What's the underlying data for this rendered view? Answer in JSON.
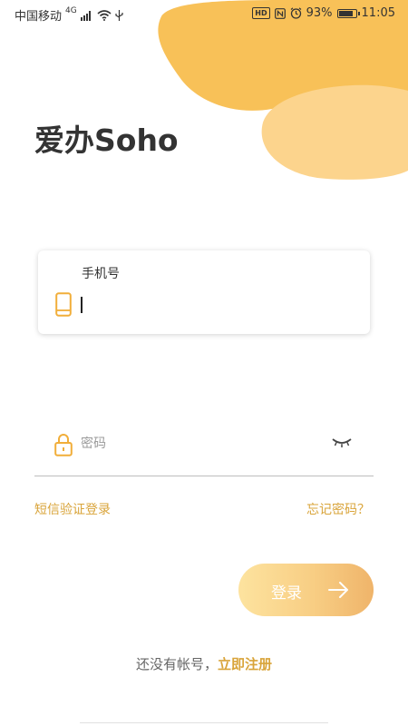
{
  "status_bar": {
    "carrier": "中国移动",
    "network": "4G",
    "hd": "HD",
    "battery": "93%",
    "battery_level": 0.93,
    "time": "11:05"
  },
  "app": {
    "title": "爱办Soho"
  },
  "login_form": {
    "phone_label": "手机号",
    "phone_value": "",
    "password_placeholder": "密码"
  },
  "links": {
    "sms_login": "短信验证登录",
    "forgot_password": "忘记密码？"
  },
  "login_button": {
    "label": "登录"
  },
  "register": {
    "prompt": "还没有帐号，",
    "link": "立即注册"
  },
  "colors": {
    "accent": "#d9a43a",
    "blob_dark": "#f8c158",
    "blob_light": "#fcd48d",
    "icon": "#f1ae3a"
  }
}
